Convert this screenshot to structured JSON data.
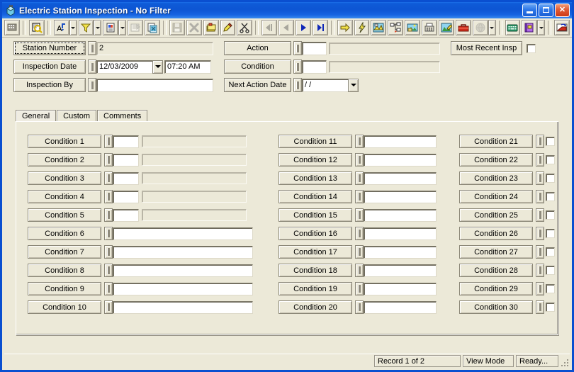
{
  "window": {
    "title": "Electric Station Inspection - No Filter",
    "icon": "app-inspection-icon",
    "buttons": {
      "minimize": "_",
      "maximize": "□",
      "close": "✕"
    }
  },
  "toolbar": {
    "items": [
      {
        "name": "grid-icon",
        "type": "button",
        "enabled": false
      },
      {
        "name": "separator",
        "type": "sep"
      },
      {
        "name": "find-record-icon",
        "type": "button",
        "enabled": true
      },
      {
        "name": "separator",
        "type": "sep"
      },
      {
        "name": "sort-icon",
        "type": "button",
        "enabled": true
      },
      {
        "name": "sort-dropdown",
        "type": "drop"
      },
      {
        "name": "filter-funnel-icon",
        "type": "button",
        "enabled": true
      },
      {
        "name": "filter-dropdown",
        "type": "drop"
      },
      {
        "name": "report-icon",
        "type": "button",
        "enabled": true
      },
      {
        "name": "report-dropdown",
        "type": "drop"
      },
      {
        "name": "print-preview-icon",
        "type": "button",
        "enabled": false
      },
      {
        "name": "copy-record-icon",
        "type": "button",
        "enabled": true
      },
      {
        "name": "separator",
        "type": "sep"
      },
      {
        "name": "save-icon",
        "type": "button",
        "enabled": false
      },
      {
        "name": "delete-icon",
        "type": "button",
        "enabled": false
      },
      {
        "name": "new-record-icon",
        "type": "button",
        "enabled": true
      },
      {
        "name": "edit-pencil-icon",
        "type": "button",
        "enabled": true
      },
      {
        "name": "cut-scissors-icon",
        "type": "button",
        "enabled": true
      },
      {
        "name": "separator",
        "type": "sep"
      },
      {
        "name": "first-record-icon",
        "type": "button",
        "enabled": false
      },
      {
        "name": "previous-record-icon",
        "type": "button",
        "enabled": false
      },
      {
        "name": "next-record-icon",
        "type": "button",
        "enabled": true
      },
      {
        "name": "last-record-icon",
        "type": "button",
        "enabled": true
      },
      {
        "name": "separator",
        "type": "sep"
      },
      {
        "name": "go-to-icon",
        "type": "button",
        "enabled": true
      },
      {
        "name": "lightning-icon",
        "type": "button",
        "enabled": true
      },
      {
        "name": "map-view-icon",
        "type": "button",
        "enabled": true
      },
      {
        "name": "hierarchy-icon",
        "type": "button",
        "enabled": true
      },
      {
        "name": "image-attach-icon",
        "type": "button",
        "enabled": true
      },
      {
        "name": "fax-icon",
        "type": "button",
        "enabled": true
      },
      {
        "name": "sketch-icon",
        "type": "button",
        "enabled": true
      },
      {
        "name": "toolbox-icon",
        "type": "button",
        "enabled": true
      },
      {
        "name": "globe-icon",
        "type": "button",
        "enabled": false
      },
      {
        "name": "globe-dropdown",
        "type": "drop"
      },
      {
        "name": "separator",
        "type": "sep"
      },
      {
        "name": "keyboard-icon",
        "type": "button",
        "enabled": true
      },
      {
        "name": "dictionary-icon",
        "type": "button",
        "enabled": true
      },
      {
        "name": "dictionary-dropdown",
        "type": "drop"
      },
      {
        "name": "separator",
        "type": "sep"
      },
      {
        "name": "export-icon",
        "type": "button",
        "enabled": true
      }
    ]
  },
  "header": {
    "fields": [
      {
        "label": "Station Number",
        "value": "2",
        "readonly": true,
        "focused": true
      },
      {
        "label": "Inspection Date",
        "value": "12/03/2009",
        "time": "07:20 AM",
        "type": "date"
      },
      {
        "label": "Inspection By",
        "value": "",
        "readonly": false
      }
    ],
    "right_fields": [
      {
        "label": "Action",
        "code": "",
        "desc": ""
      },
      {
        "label": "Condition",
        "code": "",
        "desc": ""
      },
      {
        "label": "Next Action Date",
        "value": "  /  /",
        "type": "date"
      }
    ],
    "most_recent": {
      "label": "Most Recent Insp",
      "checked": false
    }
  },
  "tabs": [
    {
      "label": "General",
      "active": true
    },
    {
      "label": "Custom",
      "active": false
    },
    {
      "label": "Comments",
      "active": false
    }
  ],
  "conditions": {
    "column1": [
      {
        "label": "Condition 1",
        "code": "",
        "desc": "",
        "layout": "code-desc"
      },
      {
        "label": "Condition 2",
        "code": "",
        "desc": "",
        "layout": "code-desc"
      },
      {
        "label": "Condition 3",
        "code": "",
        "desc": "",
        "layout": "code-desc"
      },
      {
        "label": "Condition 4",
        "code": "",
        "desc": "",
        "layout": "code-desc"
      },
      {
        "label": "Condition 5",
        "code": "",
        "desc": "",
        "layout": "code-desc"
      },
      {
        "label": "Condition 6",
        "value": "",
        "layout": "single"
      },
      {
        "label": "Condition 7",
        "value": "",
        "layout": "single"
      },
      {
        "label": "Condition 8",
        "value": "",
        "layout": "single"
      },
      {
        "label": "Condition 9",
        "value": "",
        "layout": "single"
      },
      {
        "label": "Condition 10",
        "value": "",
        "layout": "single"
      }
    ],
    "column2": [
      {
        "label": "Condition 11",
        "value": "",
        "layout": "single"
      },
      {
        "label": "Condition 12",
        "value": "",
        "layout": "single"
      },
      {
        "label": "Condition 13",
        "value": "",
        "layout": "single"
      },
      {
        "label": "Condition 14",
        "value": "",
        "layout": "single"
      },
      {
        "label": "Condition 15",
        "value": "",
        "layout": "single"
      },
      {
        "label": "Condition 16",
        "value": "",
        "layout": "single"
      },
      {
        "label": "Condition 17",
        "value": "",
        "layout": "single"
      },
      {
        "label": "Condition 18",
        "value": "",
        "layout": "single"
      },
      {
        "label": "Condition 19",
        "value": "",
        "layout": "single"
      },
      {
        "label": "Condition 20",
        "value": "",
        "layout": "single"
      }
    ],
    "column3": [
      {
        "label": "Condition 21",
        "checked": false,
        "layout": "checkbox"
      },
      {
        "label": "Condition 22",
        "checked": false,
        "layout": "checkbox"
      },
      {
        "label": "Condition 23",
        "checked": false,
        "layout": "checkbox"
      },
      {
        "label": "Condition 24",
        "checked": false,
        "layout": "checkbox"
      },
      {
        "label": "Condition 25",
        "checked": false,
        "layout": "checkbox"
      },
      {
        "label": "Condition 26",
        "checked": false,
        "layout": "checkbox"
      },
      {
        "label": "Condition 27",
        "checked": false,
        "layout": "checkbox"
      },
      {
        "label": "Condition 28",
        "checked": false,
        "layout": "checkbox"
      },
      {
        "label": "Condition 29",
        "checked": false,
        "layout": "checkbox"
      },
      {
        "label": "Condition 30",
        "checked": false,
        "layout": "checkbox"
      }
    ]
  },
  "statusbar": {
    "record": "Record 1 of 2",
    "mode": "View Mode",
    "state": "Ready..."
  },
  "colors": {
    "titlebar_blue": "#0d55d3",
    "face": "#ece9d8",
    "panel": "#efece1",
    "close_red": "#cc3a16"
  }
}
